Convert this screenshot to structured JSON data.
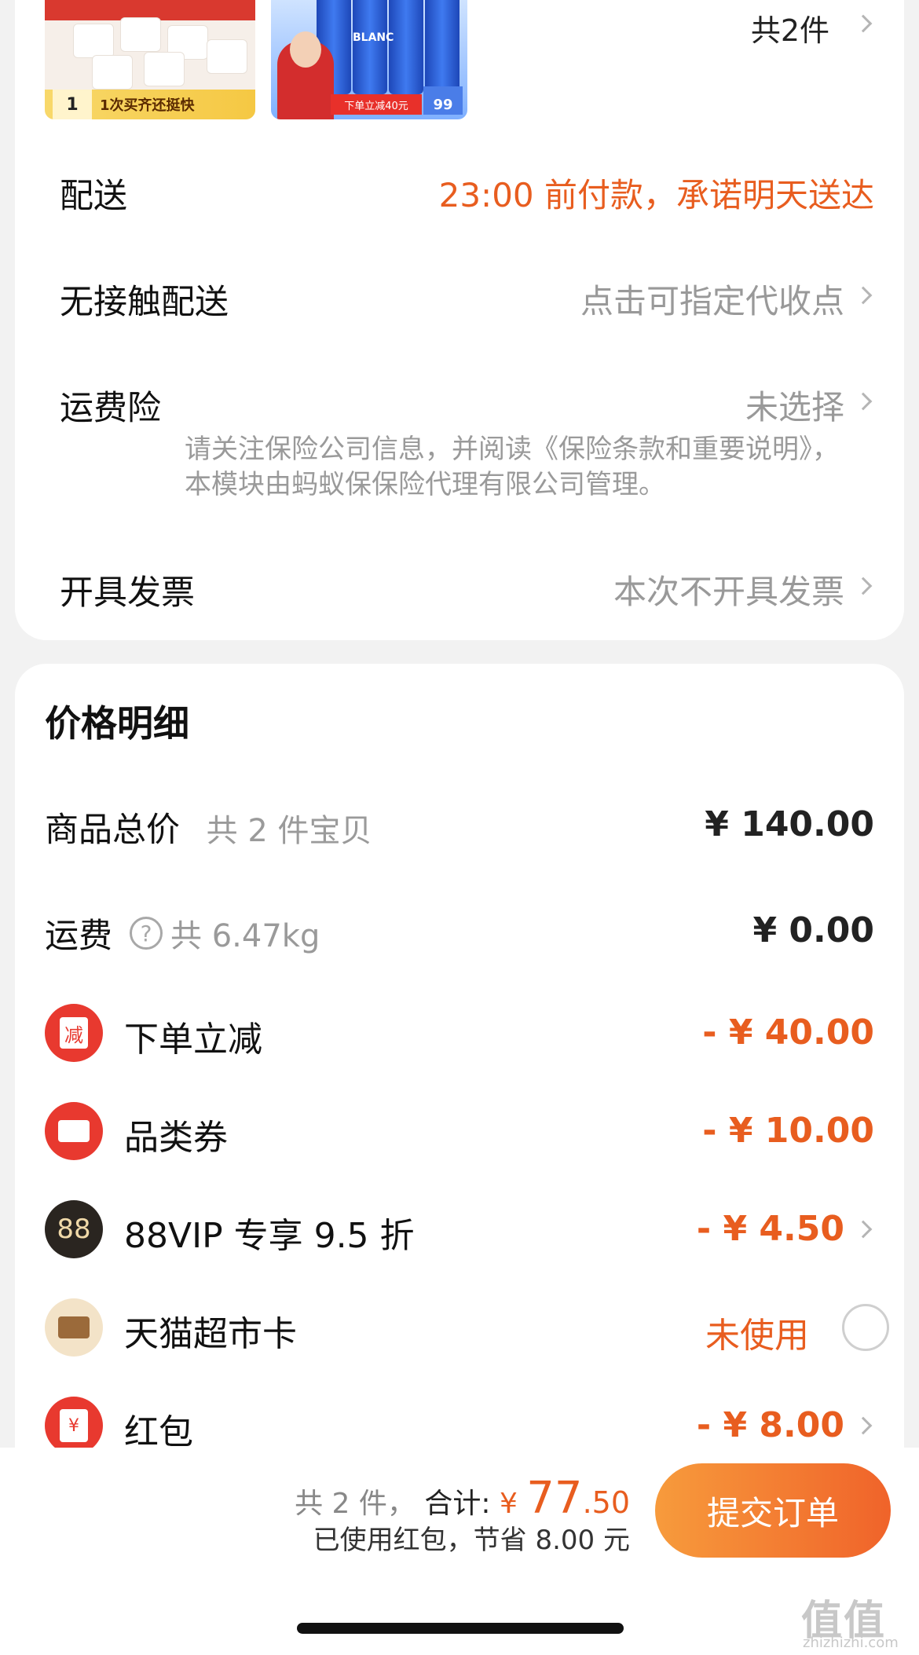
{
  "products": {
    "thumb1_badge": "1次买齐还挺快",
    "thumb1_qty": "1",
    "thumb2_promo": "下单立减40元",
    "thumb2_price": "99",
    "thumb2_brand": "BLANC",
    "total_count": "共2件"
  },
  "delivery": {
    "label": "配送",
    "value": "23:00 前付款，承诺明天送达"
  },
  "contactless": {
    "label": "无接触配送",
    "value": "点击可指定代收点"
  },
  "insurance": {
    "label": "运费险",
    "value": "未选择",
    "note": "请关注保险公司信息，并阅读《保险条款和重要说明》，本模块由蚂蚁保保险代理有限公司管理。"
  },
  "invoice": {
    "label": "开具发票",
    "value": "本次不开具发票"
  },
  "price_detail": {
    "title": "价格明细",
    "goods_total_label": "商品总价",
    "goods_total_sub": "共 2 件宝贝",
    "goods_total_value": "¥ 140.00",
    "shipping_label": "运费",
    "shipping_sub": "共 6.47kg",
    "shipping_value": "¥ 0.00",
    "discounts": [
      {
        "icon": "reduce-icon",
        "icon_text": "减",
        "label": "下单立减",
        "value": "- ¥ 40.00",
        "color": "#e8392f"
      },
      {
        "icon": "coupon-icon",
        "icon_text": "",
        "label": "品类券",
        "value": "- ¥ 10.00",
        "color": "#e8392f"
      },
      {
        "icon": "vip88-icon",
        "icon_text": "88",
        "label": "88VIP 专享 9.5 折",
        "value": "- ¥ 4.50",
        "color": "#2a2520"
      },
      {
        "icon": "supermarket-card-icon",
        "icon_text": "",
        "label": "天猫超市卡",
        "value": "未使用",
        "color": "#f3e3c8"
      },
      {
        "icon": "red-packet-icon",
        "icon_text": "¥",
        "label": "红包",
        "value": "- ¥ 8.00",
        "color": "#e8392f"
      }
    ]
  },
  "bottom": {
    "count": "共 2 件，",
    "total_label": "合计:",
    "yen": "¥",
    "total_int": "77",
    "total_dec": ".50",
    "saved": "已使用红包，节省 8.00 元",
    "submit": "提交订单"
  },
  "watermark": {
    "main": "值值值",
    "sub": "zhizhizhi.com"
  }
}
